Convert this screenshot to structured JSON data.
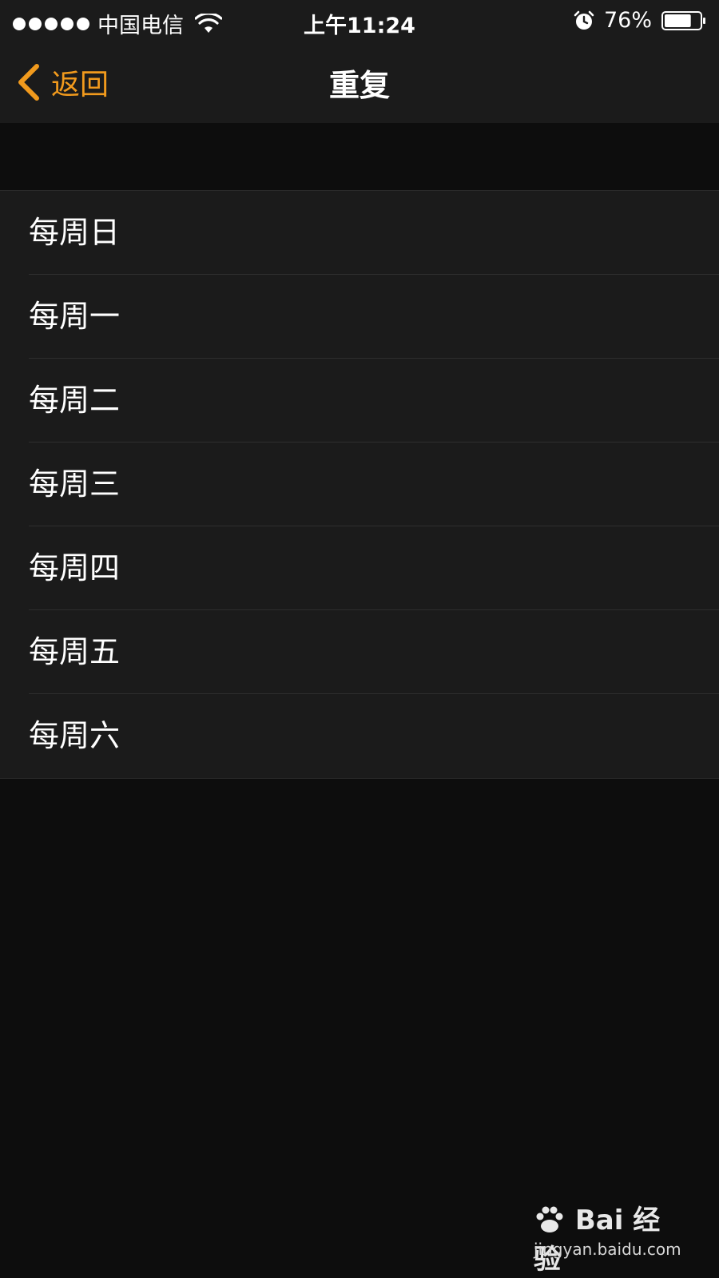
{
  "status_bar": {
    "carrier": "中国电信",
    "time": "上午11:24",
    "battery_percent": "76%",
    "battery_level": 0.76,
    "signal_bars": 5,
    "icons": [
      "signal-dots-icon",
      "wifi-icon",
      "alarm-icon",
      "battery-icon"
    ]
  },
  "nav": {
    "back_label": "返回",
    "title": "重复"
  },
  "colors": {
    "accent": "#f19a1d",
    "background": "#0d0d0d",
    "surface": "#1b1b1b",
    "text": "#ffffff"
  },
  "options": [
    {
      "label": "每周日"
    },
    {
      "label": "每周一"
    },
    {
      "label": "每周二"
    },
    {
      "label": "每周三"
    },
    {
      "label": "每周四"
    },
    {
      "label": "每周五"
    },
    {
      "label": "每周六"
    }
  ],
  "watermark": {
    "brand": "Bai 经验",
    "url": "jingyan.baidu.com"
  }
}
